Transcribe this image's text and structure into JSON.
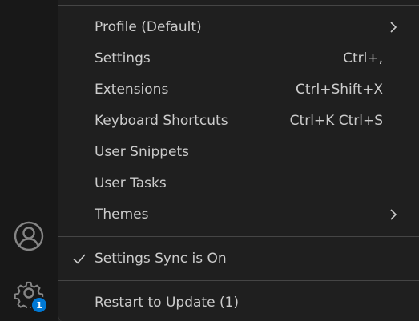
{
  "activity_bar": {
    "manage_badge": "1"
  },
  "menu": {
    "items": [
      {
        "label": "Profile (Default)",
        "shortcut": ""
      },
      {
        "label": "Settings",
        "shortcut": "Ctrl+,"
      },
      {
        "label": "Extensions",
        "shortcut": "Ctrl+Shift+X"
      },
      {
        "label": "Keyboard Shortcuts",
        "shortcut": "Ctrl+K Ctrl+S"
      },
      {
        "label": "User Snippets",
        "shortcut": ""
      },
      {
        "label": "User Tasks",
        "shortcut": ""
      },
      {
        "label": "Themes",
        "shortcut": ""
      },
      {
        "label": "Settings Sync is On",
        "shortcut": ""
      },
      {
        "label": "Restart to Update (1)",
        "shortcut": ""
      }
    ]
  },
  "colors": {
    "menu_background": "#1f1f1f",
    "activity_bar_background": "#181818",
    "text": "#cccccc",
    "separator": "#454545",
    "badge": "#0078d4"
  }
}
